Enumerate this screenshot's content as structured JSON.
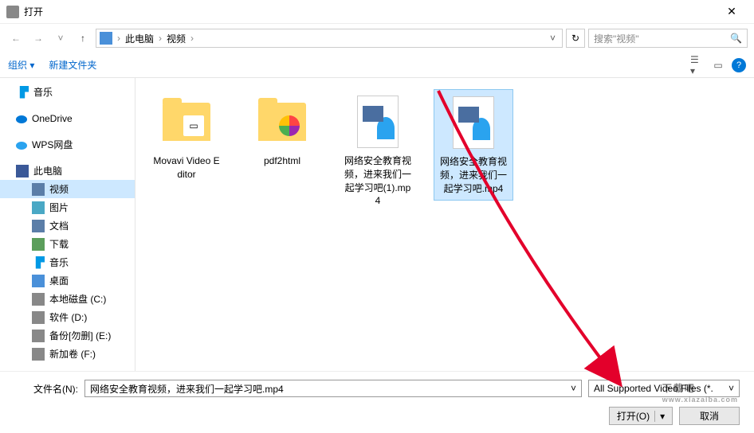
{
  "title": "打开",
  "breadcrumb": {
    "root": "此电脑",
    "folder": "视频"
  },
  "search_placeholder": "搜索\"视频\"",
  "toolbar": {
    "organize": "组织",
    "newfolder": "新建文件夹"
  },
  "sidebar": {
    "music": "音乐",
    "onedrive": "OneDrive",
    "wps": "WPS网盘",
    "thispc": "此电脑",
    "video": "视频",
    "pictures": "图片",
    "documents": "文档",
    "downloads": "下载",
    "music2": "音乐",
    "desktop": "桌面",
    "c": "本地磁盘 (C:)",
    "d": "软件 (D:)",
    "e": "备份[勿删] (E:)",
    "new": "新加卷 (F:)"
  },
  "files": {
    "f1": "Movavi Video Editor",
    "f2": "pdf2html",
    "f3": "网络安全教育视频，进来我们一起学习吧(1).mp4",
    "f4": "网络安全教育视频，进来我们一起学习吧.mp4"
  },
  "filename_label": "文件名(N):",
  "filename_value": "网络安全教育视频，进来我们一起学习吧.mp4",
  "filetype": "All Supported Video Files (*.",
  "buttons": {
    "open": "打开(O)",
    "cancel": "取消"
  },
  "watermark": {
    "main": "下载吧",
    "sub": "www.xiazaiba.com"
  }
}
